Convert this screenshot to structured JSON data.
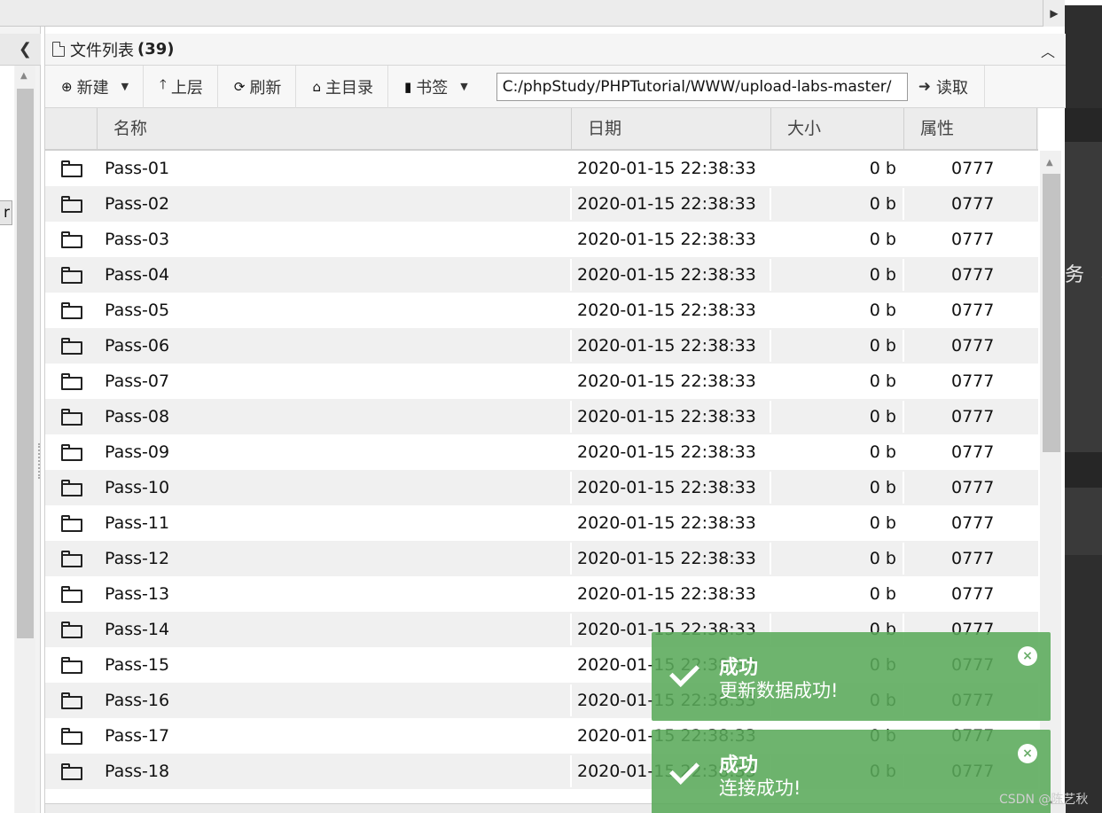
{
  "panel": {
    "title": "文件列表",
    "count": "(39)"
  },
  "toolbar": {
    "new_label": "新建",
    "up_label": "上层",
    "refresh_label": "刷新",
    "home_label": "主目录",
    "bookmark_label": "书签",
    "path_value": "C:/phpStudy/PHPTutorial/WWW/upload-labs-master/",
    "read_label": "读取"
  },
  "columns": {
    "name": "名称",
    "date": "日期",
    "size": "大小",
    "attr": "属性"
  },
  "rows": [
    {
      "name": "Pass-01",
      "date": "2020-01-15 22:38:33",
      "size": "0 b",
      "attr": "0777"
    },
    {
      "name": "Pass-02",
      "date": "2020-01-15 22:38:33",
      "size": "0 b",
      "attr": "0777"
    },
    {
      "name": "Pass-03",
      "date": "2020-01-15 22:38:33",
      "size": "0 b",
      "attr": "0777"
    },
    {
      "name": "Pass-04",
      "date": "2020-01-15 22:38:33",
      "size": "0 b",
      "attr": "0777"
    },
    {
      "name": "Pass-05",
      "date": "2020-01-15 22:38:33",
      "size": "0 b",
      "attr": "0777"
    },
    {
      "name": "Pass-06",
      "date": "2020-01-15 22:38:33",
      "size": "0 b",
      "attr": "0777"
    },
    {
      "name": "Pass-07",
      "date": "2020-01-15 22:38:33",
      "size": "0 b",
      "attr": "0777"
    },
    {
      "name": "Pass-08",
      "date": "2020-01-15 22:38:33",
      "size": "0 b",
      "attr": "0777"
    },
    {
      "name": "Pass-09",
      "date": "2020-01-15 22:38:33",
      "size": "0 b",
      "attr": "0777"
    },
    {
      "name": "Pass-10",
      "date": "2020-01-15 22:38:33",
      "size": "0 b",
      "attr": "0777"
    },
    {
      "name": "Pass-11",
      "date": "2020-01-15 22:38:33",
      "size": "0 b",
      "attr": "0777"
    },
    {
      "name": "Pass-12",
      "date": "2020-01-15 22:38:33",
      "size": "0 b",
      "attr": "0777"
    },
    {
      "name": "Pass-13",
      "date": "2020-01-15 22:38:33",
      "size": "0 b",
      "attr": "0777"
    },
    {
      "name": "Pass-14",
      "date": "2020-01-15 22:38:33",
      "size": "0 b",
      "attr": "0777"
    },
    {
      "name": "Pass-15",
      "date": "2020-01-15 22:38:33",
      "size": "0 b",
      "attr": "0777"
    },
    {
      "name": "Pass-16",
      "date": "2020-01-15 22:38:33",
      "size": "0 b",
      "attr": "0777"
    },
    {
      "name": "Pass-17",
      "date": "2020-01-15 22:38:33",
      "size": "0 b",
      "attr": "0777"
    },
    {
      "name": "Pass-18",
      "date": "2020-01-15 22:38:33",
      "size": "0 b",
      "attr": "0777"
    }
  ],
  "toasts": [
    {
      "title": "成功",
      "message": "更新数据成功!"
    },
    {
      "title": "成功",
      "message": "连接成功!"
    }
  ],
  "left_panel": {
    "button_fragment": "r"
  },
  "background_fragment": "务 器",
  "watermark": "CSDN @陈艺秋",
  "icons": {
    "new": "plus-circle-icon",
    "up": "arrow-up-icon",
    "refresh": "refresh-icon",
    "home": "home-icon",
    "bookmark": "bookmark-icon",
    "read": "arrow-right-icon",
    "folder": "folder-icon",
    "file": "file-icon",
    "success": "check-icon",
    "close": "close-circle-icon"
  },
  "colors": {
    "toast_bg": "#5aaa5a",
    "toolbar_bg": "#f7f7f7",
    "row_alt": "#f0f0f0"
  }
}
